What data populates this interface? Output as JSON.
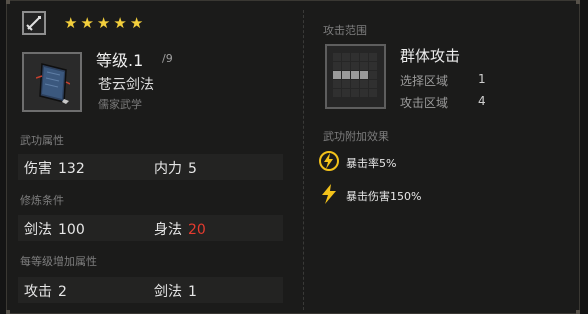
{
  "header": {
    "type_icon": "sword-icon",
    "stars": [
      "★",
      "★",
      "★",
      "★",
      "★"
    ],
    "level_label": "等级.1",
    "level_max": "/9",
    "skill_name": "苍云剑法",
    "skill_school": "儒家武学"
  },
  "attributes": {
    "title": "武功属性",
    "damage_label": "伤害",
    "damage_value": "132",
    "internal_label": "内力",
    "internal_value": "5"
  },
  "requirements": {
    "title": "修炼条件",
    "sword_label": "剑法",
    "sword_value": "100",
    "agility_label": "身法",
    "agility_value": "20",
    "agility_color": "#e53b2f"
  },
  "per_level": {
    "title": "每等级增加属性",
    "attack_label": "攻击",
    "attack_value": "2",
    "sword_label": "剑法",
    "sword_value": "1"
  },
  "range": {
    "title": "攻击范围",
    "name": "群体攻击",
    "select_label": "选择区域",
    "select_value": "1",
    "attack_label": "攻击区域",
    "attack_value": "4"
  },
  "effects": {
    "title": "武功附加效果",
    "items": [
      {
        "icon": "lightning-circle-icon",
        "text": "暴击率5%"
      },
      {
        "icon": "lightning-icon",
        "text": "暴击伤害150%"
      }
    ]
  },
  "colors": {
    "star": "#f3cf3c",
    "effect_icon": "#f3c21a"
  }
}
